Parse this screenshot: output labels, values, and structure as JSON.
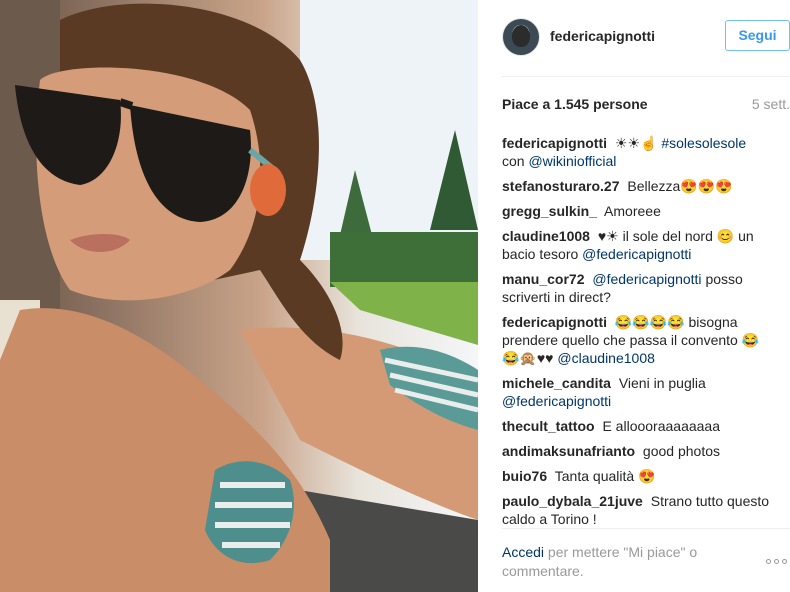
{
  "post": {
    "author": "federicapignotti",
    "follow_label": "Segui",
    "likes_text": "Piace a 1.545 persone",
    "time": "5 sett.",
    "photo_description_icon": "photo"
  },
  "comments": [
    {
      "user": "federicapignotti",
      "text": "☀☀☝",
      "mention": "#solesolesole",
      "after": "con",
      "mention2": "@wikiniofficial"
    },
    {
      "user": "stefanosturaro.27",
      "text": "Bellezza😍😍😍"
    },
    {
      "user": "gregg_sulkin_",
      "text": "Amoreee"
    },
    {
      "user": "claudine1008",
      "text": "♥☀ il sole del nord 😊 un bacio tesoro",
      "mention": "@federicapignotti"
    },
    {
      "user": "manu_cor72",
      "mention": "@federicapignotti",
      "text": "posso scriverti in direct?"
    },
    {
      "user": "federicapignotti",
      "text": "😂😂😂😂 bisogna prendere quello che passa il convento 😂😂🙊♥♥",
      "mention": "@claudine1008"
    },
    {
      "user": "michele_candita",
      "text": "Vieni in puglia",
      "mention": "@federicapignotti"
    },
    {
      "user": "thecult_tattoo",
      "text": "E alloooraaaaaaaa"
    },
    {
      "user": "andimaksunafrianto",
      "text": "good photos"
    },
    {
      "user": "buio76",
      "text": "Tanta qualità 😍"
    },
    {
      "user": "paulo_dybala_21juve",
      "text": "Strano tutto questo caldo a Torino !"
    }
  ],
  "footer": {
    "login_label": "Accedi",
    "rest": "per mettere \"Mi piace\" o commentare."
  }
}
